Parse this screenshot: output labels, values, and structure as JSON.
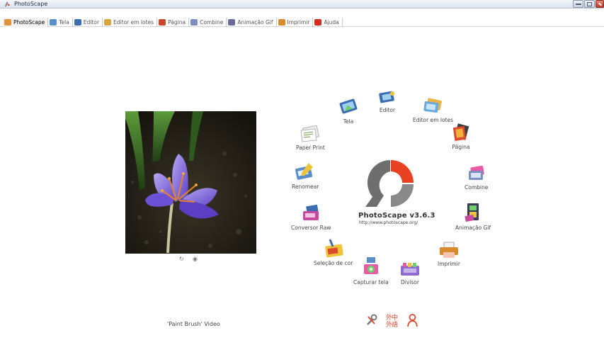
{
  "window": {
    "title": "PhotoScape"
  },
  "tabs": [
    {
      "label": "PhotoScape",
      "icon": "photoscape-icon",
      "color": "#e0943a",
      "active": true
    },
    {
      "label": "Tela",
      "icon": "viewer-icon",
      "color": "#5b8ec9"
    },
    {
      "label": "Editor",
      "icon": "editor-icon",
      "color": "#3b6db3"
    },
    {
      "label": "Editor em lotes",
      "icon": "batch-editor-icon",
      "color": "#d9a43a"
    },
    {
      "label": "Página",
      "icon": "page-icon",
      "color": "#c8482e"
    },
    {
      "label": "Combine",
      "icon": "combine-icon",
      "color": "#7b8dc4"
    },
    {
      "label": "Animação Gif",
      "icon": "animated-gif-icon",
      "color": "#6b6b9a"
    },
    {
      "label": "Imprimir",
      "icon": "print-icon",
      "color": "#d98a2a"
    },
    {
      "label": "Ajuda",
      "icon": "help-icon",
      "color": "#d62c1f"
    }
  ],
  "photo": {
    "controls": [
      "rotate-icon",
      "view-icon"
    ],
    "video_label": "'Paint Brush' Video"
  },
  "logo": {
    "name": "PhotoScape v3.6.3",
    "url": "http://www.photoscape.org/",
    "colors": {
      "red": "#e84124",
      "gray": "#6e6e6e"
    }
  },
  "modules": [
    {
      "key": "editor",
      "label": "Editor"
    },
    {
      "key": "batch",
      "label": "Editor em lotes"
    },
    {
      "key": "page",
      "label": "Página"
    },
    {
      "key": "combine",
      "label": "Combine"
    },
    {
      "key": "gif",
      "label": "Animação Gif"
    },
    {
      "key": "print",
      "label": "Imprimir"
    },
    {
      "key": "splitter",
      "label": "Divisor"
    },
    {
      "key": "capture",
      "label": "Capturar tela"
    },
    {
      "key": "colorpicker",
      "label": "Seleção de cor"
    },
    {
      "key": "raw",
      "label": "Conversor Raw"
    },
    {
      "key": "rename",
      "label": "Renomear"
    },
    {
      "key": "paperprint",
      "label": "Paper Print"
    },
    {
      "key": "viewer",
      "label": "Tela"
    }
  ],
  "bottom_icons": [
    "tools-icon",
    "language-icon",
    "user-icon"
  ]
}
